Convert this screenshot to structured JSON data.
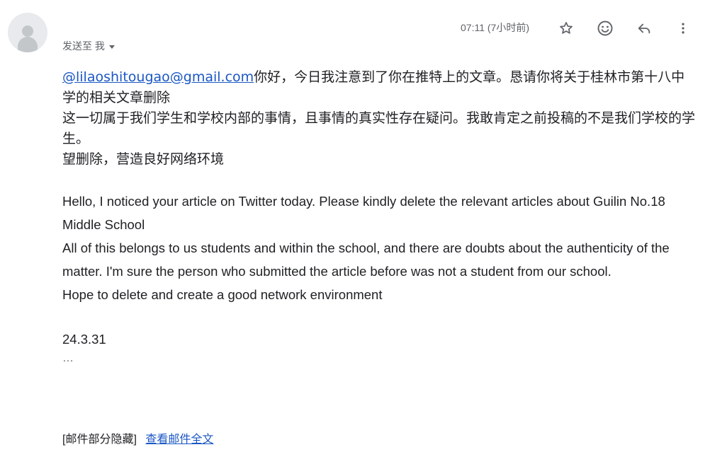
{
  "header": {
    "recipients_label": "发送至 我",
    "time": "07:11 (7小时前)",
    "icons": {
      "star": "star-icon",
      "emoji": "emoji-icon",
      "reply": "reply-icon",
      "more": "more-vert-icon"
    },
    "colors": {
      "icon": "#5f6368",
      "link": "#1a57c4"
    }
  },
  "message": {
    "mention_link": "@lilaoshitougao@gmail.com",
    "zh_line1_rest": "你好，今日我注意到了你在推特上的文章。恳请你将关于桂林市第十八中学的相关文章删除",
    "zh_line2": "这一切属于我们学生和学校内部的事情，且事情的真实性存在疑问。我敢肯定之前投稿的不是我们学校的学生。",
    "zh_line3": "望删除，营造良好网络环境",
    "en_line1": "Hello, I noticed your article on Twitter today. Please kindly delete the relevant articles about Guilin No.18 Middle School",
    "en_line2": "All of this belongs to us students and within the school, and there are doubts about the authenticity of the matter. I'm sure the person who submitted the article before was not a student from our school.",
    "en_line3": "Hope to delete and create a good network environment",
    "date": "24.3.31",
    "ellipsis": "…"
  },
  "footer": {
    "clipped_label": "[邮件部分隐藏]",
    "view_full_label": "查看邮件全文"
  }
}
